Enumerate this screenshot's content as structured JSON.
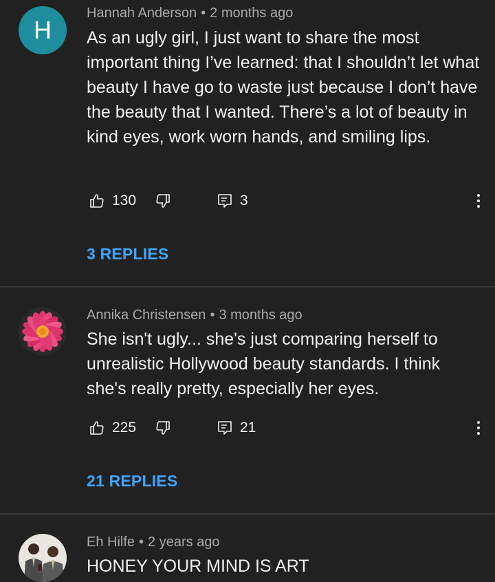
{
  "comments": [
    {
      "avatar_letter": "H",
      "author": "Hannah Anderson",
      "separator": "•",
      "time": "2 months ago",
      "text": "As an ugly girl, I just want to share the most important thing I’ve learned: that I shouldn’t let what beauty I have go to waste just because I don’t have the beauty that I wanted. There’s a lot of beauty in kind eyes, work worn hands, and smiling lips.",
      "likes": "130",
      "reply_count": "3",
      "replies_label": "3 REPLIES"
    },
    {
      "author": "Annika Christensen",
      "separator": "•",
      "time": "3 months ago",
      "text": "She isn't ugly... she's just comparing herself to unrealistic Hollywood beauty standards. I think she's really pretty, especially her eyes.",
      "likes": "225",
      "reply_count": "21",
      "replies_label": "21 REPLIES"
    },
    {
      "author": "Eh Hilfe",
      "separator": "•",
      "time": "2 years ago",
      "text": "HONEY YOUR MIND IS ART"
    }
  ],
  "icons": {
    "like": "thumbs-up-icon",
    "dislike": "thumbs-down-icon",
    "reply": "comment-icon",
    "more": "more-vert-icon"
  },
  "colors": {
    "background": "#212121",
    "accent": "#3ea6ff",
    "avatar_h": "#1e8e9e",
    "meta_text": "#aaaaaa"
  }
}
